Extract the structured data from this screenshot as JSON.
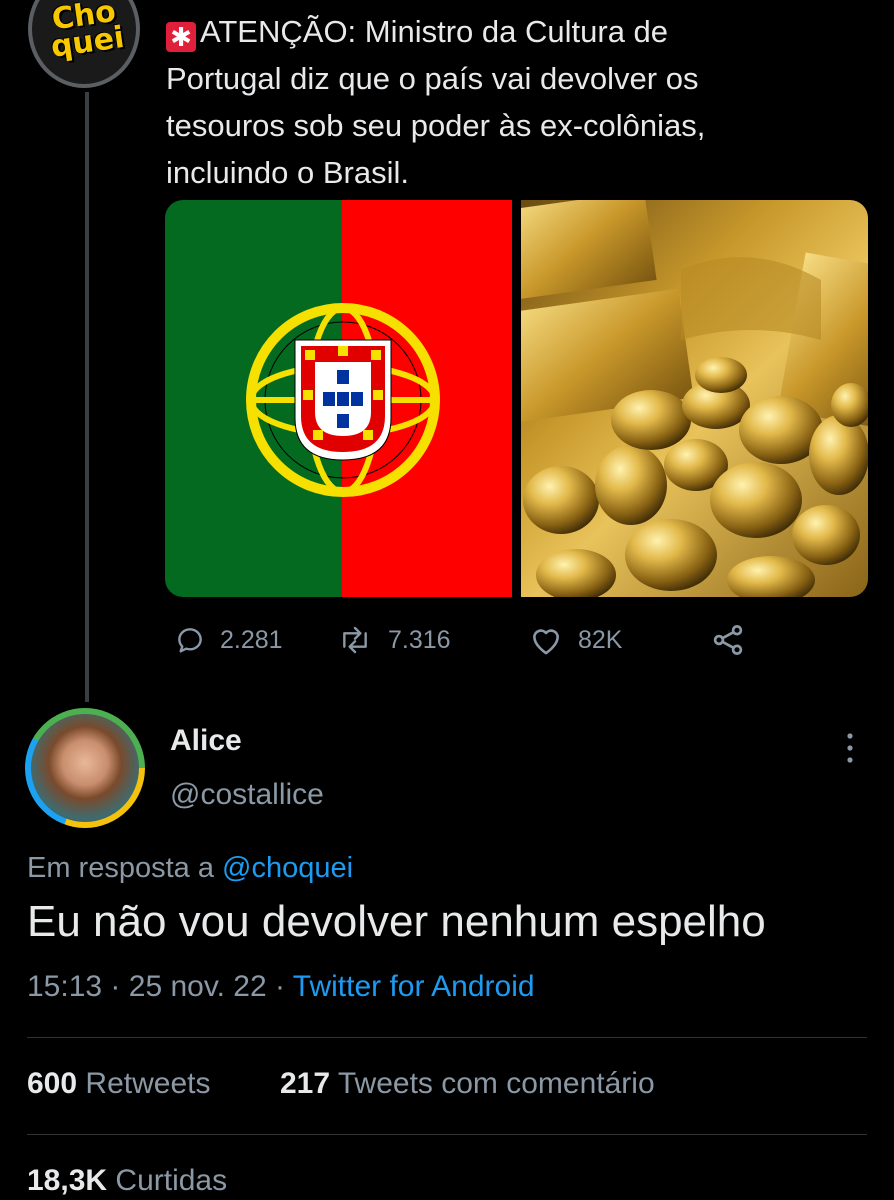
{
  "original_tweet": {
    "author_avatar_text": [
      "Cho",
      "quei"
    ],
    "alert_icon": "rotating-light-icon",
    "text": "ATENÇÃO: Ministro da Cultura de Portugal diz que o país vai devolver os tesouros sob seu poder às ex-colônias, incluindo o Brasil.",
    "text_lines": [
      "ATENÇÃO: Ministro da Cultura de",
      "Portugal diz que o país vai devolver os",
      "tesouros sob seu poder às ex-colônias,",
      "incluindo o Brasil."
    ],
    "media": [
      "portugal-flag-image",
      "gold-nuggets-image"
    ],
    "actions": {
      "replies": "2.281",
      "retweets": "7.316",
      "likes": "82K"
    }
  },
  "reply": {
    "name": "Alice",
    "handle": "@costallice",
    "reply_prefix": "Em resposta a",
    "reply_to": "@choquei",
    "text": "Eu não vou devolver nenhum espelho",
    "time": "15:13",
    "date": "25 nov. 22",
    "source": "Twitter for Android",
    "separator": "·"
  },
  "stats": {
    "retweets_count": "600",
    "retweets_label": "Retweets",
    "quotes_count": "217",
    "quotes_label": "Tweets com comentário",
    "likes_count": "18,3K",
    "likes_label": "Curtidas"
  },
  "colors": {
    "background": "#000000",
    "text": "#e7e9ea",
    "secondary": "#8b98a5",
    "link": "#1d9bf0"
  }
}
